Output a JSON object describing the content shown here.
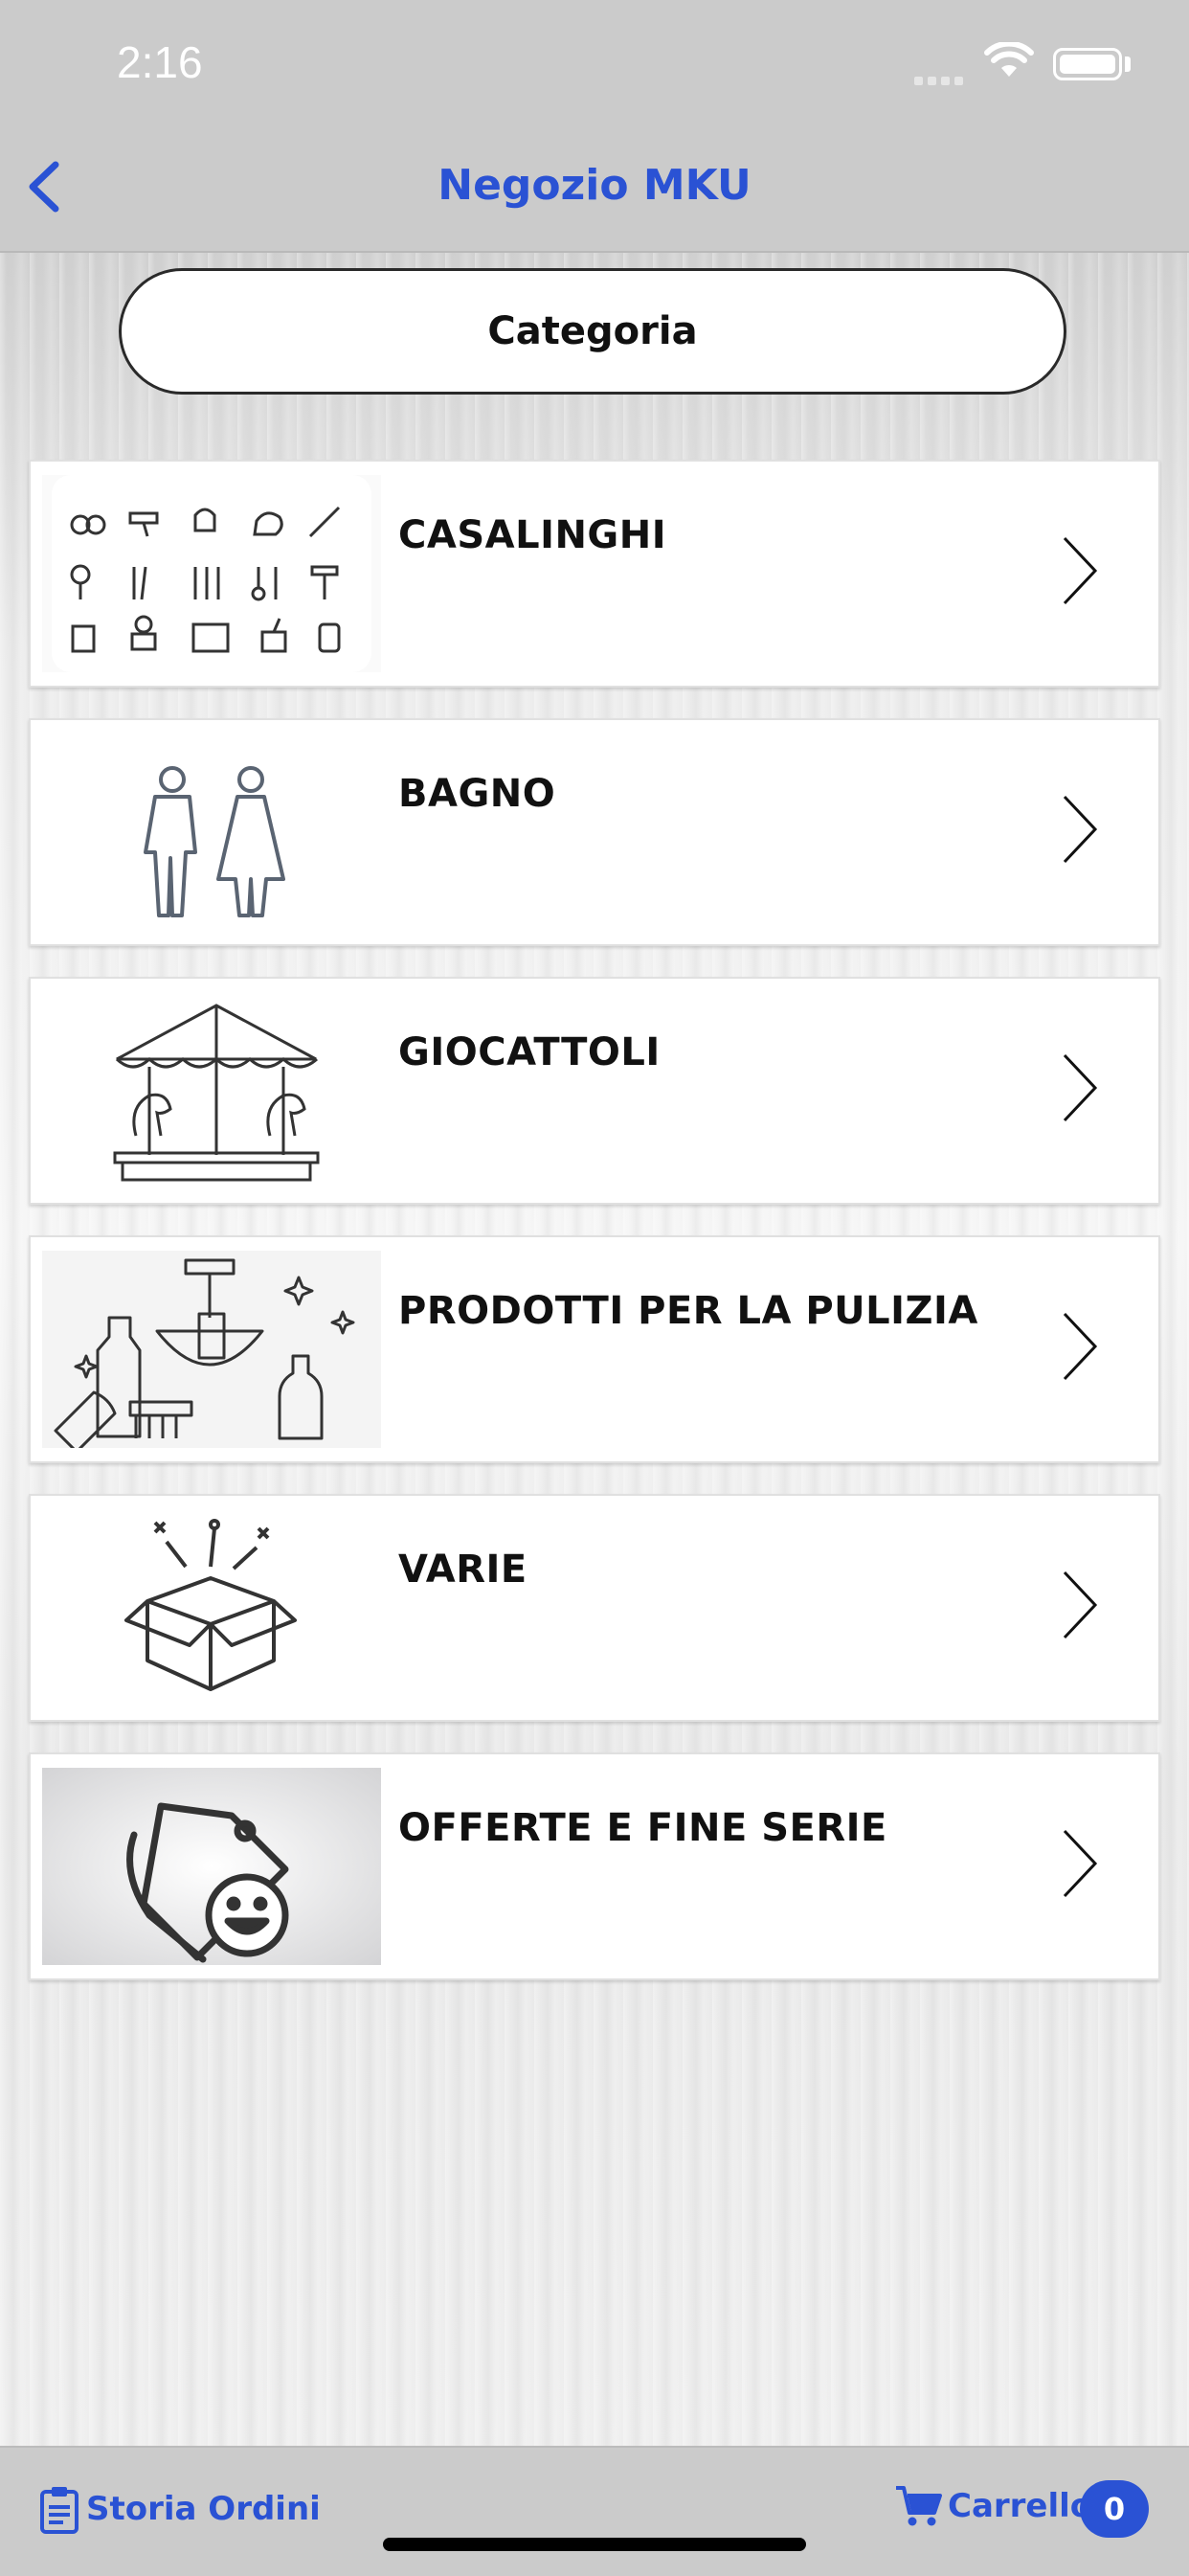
{
  "status_bar": {
    "time": "2:16"
  },
  "nav": {
    "title": "Negozio MKU"
  },
  "category_button": {
    "label": "Categoria"
  },
  "categories": [
    {
      "label": "CASALINGHI",
      "icon": "kitchen-utensils-icon"
    },
    {
      "label": "BAGNO",
      "icon": "restroom-icon"
    },
    {
      "label": "GIOCATTOLI",
      "icon": "carousel-icon"
    },
    {
      "label": "PRODOTTI PER LA PULIZIA",
      "icon": "cleaning-products-icon"
    },
    {
      "label": "VARIE",
      "icon": "gift-box-icon"
    },
    {
      "label": "OFFERTE E FINE SERIE",
      "icon": "price-tag-smile-icon"
    }
  ],
  "tab_bar": {
    "orders_label": "Storia Ordini",
    "cart_label": "Carrello",
    "cart_count": "0"
  },
  "colors": {
    "accent": "#2a52d4",
    "bar_bg": "#cbcbcb"
  }
}
